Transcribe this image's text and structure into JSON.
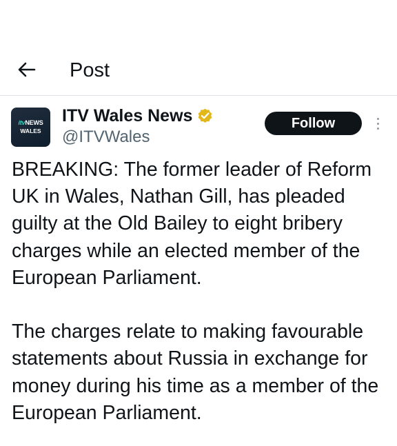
{
  "header": {
    "title": "Post",
    "back_icon": "arrow-left-icon"
  },
  "post": {
    "account": {
      "name": "ITV Wales News",
      "handle": "@ITVWales",
      "verified_icon": "verified-badge-icon",
      "verified_color": "#e2b719",
      "avatar": {
        "brand_itv": "itv",
        "brand_news": "NEWS",
        "region": "WALES"
      }
    },
    "follow_label": "Follow",
    "more_icon": "more-vertical-icon",
    "paragraphs": [
      "BREAKING: The former leader of Reform UK in Wales, Nathan Gill, has pleaded guilty at the Old Bailey to eight bribery charges while an elected member of the European Parliament.",
      "The charges relate to making favourable statements about Russia in exchange for money during his time as a member of the European Parliament."
    ]
  },
  "colors": {
    "text": "#0f1419",
    "secondary": "#536471",
    "button_bg": "#0f1419",
    "divider": "#dcdfe3"
  }
}
